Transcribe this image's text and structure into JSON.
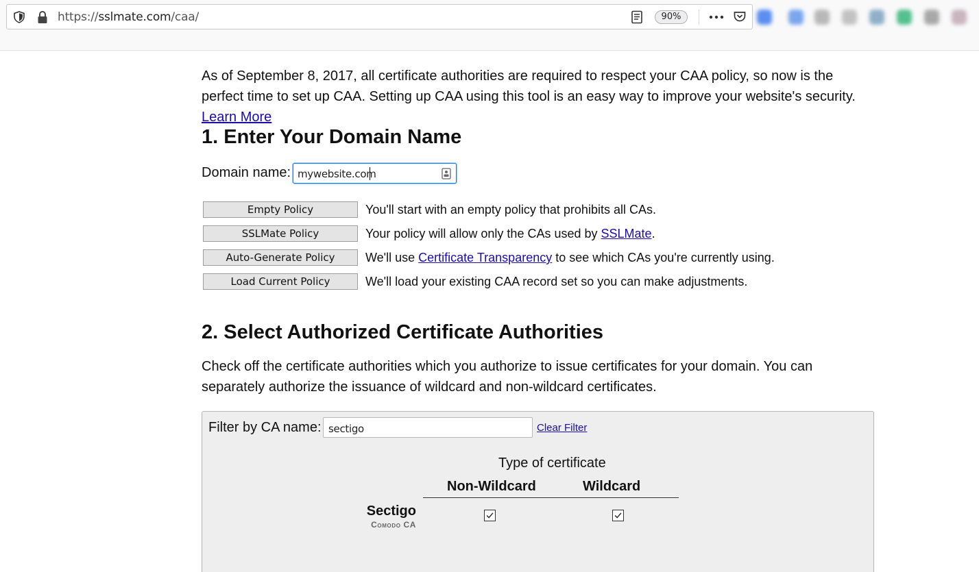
{
  "browser": {
    "url_scheme": "https://",
    "url_host": "sslmate.com",
    "url_path": "/caa/",
    "zoom": "90%"
  },
  "intro": {
    "text": "As of September 8, 2017, all certificate authorities are required to respect your CAA policy, so now is the perfect time to set up CAA. Setting up CAA using this tool is an easy way to improve your website's security. ",
    "link": "Learn More"
  },
  "step1": {
    "title": "1. Enter Your Domain Name",
    "domain_label": "Domain name:",
    "domain_value": "mywebsite.com",
    "policies": [
      {
        "button": "Empty Policy",
        "pre": "You'll start with an empty policy that prohibits all CAs.",
        "link": "",
        "post": ""
      },
      {
        "button": "SSLMate Policy",
        "pre": "Your policy will allow only the CAs used by ",
        "link": "SSLMate",
        "post": "."
      },
      {
        "button": "Auto-Generate Policy",
        "pre": "We'll use ",
        "link": "Certificate Transparency",
        "post": " to see which CAs you're currently using."
      },
      {
        "button": "Load Current Policy",
        "pre": "We'll load your existing CAA record set so you can make adjustments.",
        "link": "",
        "post": ""
      }
    ]
  },
  "step2": {
    "title": "2. Select Authorized Certificate Authorities",
    "description": "Check off the certificate authorities which you authorize to issue certificates for your domain. You can separately authorize the issuance of wildcard and non-wildcard certificates.",
    "filter": {
      "label": "Filter by CA name:",
      "value": "sectigo",
      "clear_label": "Clear Filter"
    },
    "table": {
      "type_title": "Type of certificate",
      "col_non_wildcard": "Non-Wildcard",
      "col_wildcard": "Wildcard",
      "rows": [
        {
          "name": "Sectigo",
          "subname": "Comodo CA",
          "non_wildcard": true,
          "wildcard": true
        }
      ]
    }
  }
}
